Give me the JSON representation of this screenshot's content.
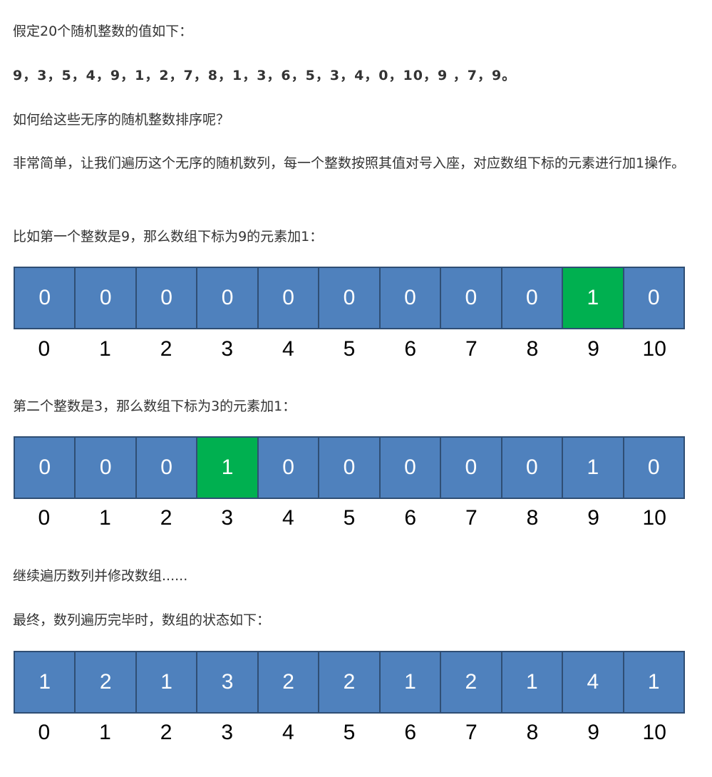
{
  "paragraphs": {
    "p1": "假定20个随机整数的值如下：",
    "p2": "9，3，5，4，9，1，2，7，8，1，3，6，5，3，4，0，10，9 ，7，9。",
    "p3": "如何给这些无序的随机整数排序呢？",
    "p4": "非常简单，让我们遍历这个无序的随机数列，每一个整数按照其值对号入座，对应数组下标的元素进行加1操作。",
    "p5": "比如第一个整数是9，那么数组下标为9的元素加1：",
    "p6": "第二个整数是3，那么数组下标为3的元素加1：",
    "p7": "继续遍历数列并修改数组......",
    "p8": "最终，数列遍历完毕时，数组的状态如下："
  },
  "colors": {
    "cell": "#4f81bd",
    "cell_highlight": "#00b050",
    "cell_border": "#2f4e74"
  },
  "arrays": [
    {
      "values": [
        "0",
        "0",
        "0",
        "0",
        "0",
        "0",
        "0",
        "0",
        "0",
        "1",
        "0"
      ],
      "indices": [
        "0",
        "1",
        "2",
        "3",
        "4",
        "5",
        "6",
        "7",
        "8",
        "9",
        "10"
      ],
      "highlight": 9
    },
    {
      "values": [
        "0",
        "0",
        "0",
        "1",
        "0",
        "0",
        "0",
        "0",
        "0",
        "1",
        "0"
      ],
      "indices": [
        "0",
        "1",
        "2",
        "3",
        "4",
        "5",
        "6",
        "7",
        "8",
        "9",
        "10"
      ],
      "highlight": 3
    },
    {
      "values": [
        "1",
        "2",
        "1",
        "3",
        "2",
        "2",
        "1",
        "2",
        "1",
        "4",
        "1"
      ],
      "indices": [
        "0",
        "1",
        "2",
        "3",
        "4",
        "5",
        "6",
        "7",
        "8",
        "9",
        "10"
      ],
      "highlight": -1
    }
  ]
}
